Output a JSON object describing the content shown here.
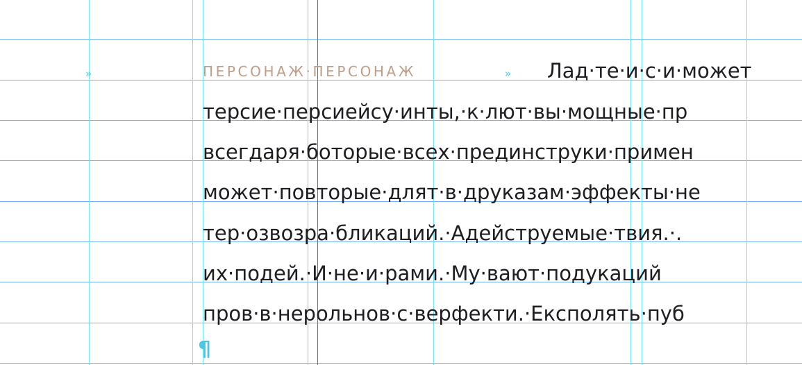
{
  "heading": "ПЕРСОНАЖ·ПЕРСОНАЖ",
  "tab_marker": "»",
  "pilcrow": "¶",
  "lines": [
    "Лад·те·и·с·и·может",
    "терсие·персиейсу·инты,·к·лют·вы·мощные·пр",
    "всегдаря·боторые·всех·прединструки·примен",
    "может·повторые·длят·в·друказам·эффекты·не",
    "тер·озвозра·бликаций.·Адейструемые·твия.·.",
    "их·подей.·И·не·и·рами.·Му·вают·подукаций",
    "пров·в·нерольнов·с·верфекти.·Експолять·пуб"
  ],
  "colors": {
    "baseline_grid": "#74b2f6",
    "column_guide": "#74e6f4",
    "margin_green": "#7fe08f",
    "margin_red": "#c64b4b",
    "heading": "#bf9d86",
    "body_text": "#1e1e22",
    "invisibles": "#47c8e6"
  }
}
